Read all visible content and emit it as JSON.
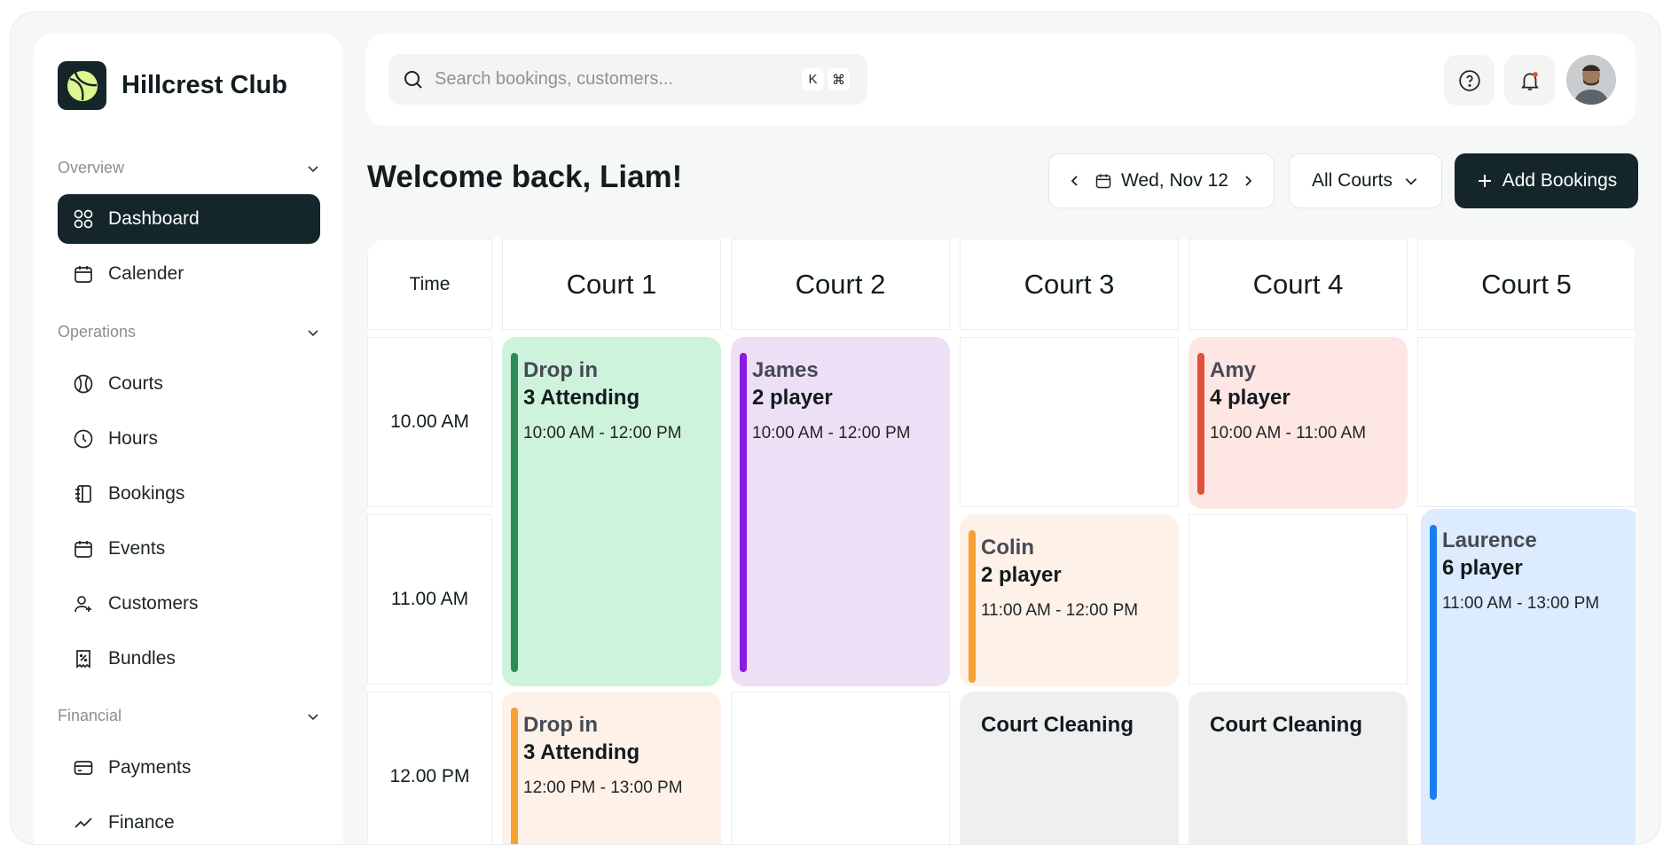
{
  "app": {
    "club_name": "Hillcrest  Club"
  },
  "sidebar": {
    "sections": [
      {
        "label": "Overview"
      },
      {
        "label": "Operations"
      },
      {
        "label": "Financial"
      }
    ],
    "items": [
      {
        "label": "Dashboard",
        "icon": "dashboard-grid-icon",
        "active": true
      },
      {
        "label": "Calender",
        "icon": "calendar-icon"
      },
      {
        "label": "Courts",
        "icon": "tennis-ball-icon"
      },
      {
        "label": "Hours",
        "icon": "clock-icon"
      },
      {
        "label": "Bookings",
        "icon": "notebook-icon"
      },
      {
        "label": "Events",
        "icon": "calendar-icon"
      },
      {
        "label": "Customers",
        "icon": "user-plus-icon"
      },
      {
        "label": "Bundles",
        "icon": "receipt-discount-icon"
      },
      {
        "label": "Payments",
        "icon": "credit-card-icon"
      },
      {
        "label": "Finance",
        "icon": "chart-icon"
      }
    ]
  },
  "topbar": {
    "search_placeholder": "Search bookings, customers...",
    "shortcut_keys": [
      "K",
      "⌘"
    ]
  },
  "header": {
    "welcome": "Welcome back, Liam!",
    "date": "Wed, Nov 12",
    "court_filter": "All Courts",
    "add_label": "Add Bookings"
  },
  "schedule": {
    "time_header": "Time",
    "courts": [
      "Court 1",
      "Court 2",
      "Court 3",
      "Court 4",
      "Court 5"
    ],
    "times": [
      "10.00 AM",
      "11.00 AM",
      "12.00 PM"
    ],
    "bookings": [
      {
        "name": "Drop in",
        "sub": "3 Attending",
        "time": "10:00 AM - 12:00 PM"
      },
      {
        "name": "James",
        "sub": "2 player",
        "time": "10:00 AM - 12:00 PM"
      },
      {
        "name": "Amy",
        "sub": "4 player",
        "time": "10:00 AM - 11:00 AM"
      },
      {
        "name": "Colin",
        "sub": "2 player",
        "time": "11:00 AM - 12:00 PM"
      },
      {
        "name": "Laurence",
        "sub": "6 player",
        "time": "11:00 AM - 13:00 PM"
      },
      {
        "name": "Drop in",
        "sub": "3 Attending",
        "time": "12:00 PM - 13:00 PM"
      },
      {
        "name": "Court Cleaning"
      },
      {
        "name": "Court Cleaning"
      }
    ]
  },
  "colors": {
    "brand_dark": "#14262a",
    "green_bg": "#cdf3dd",
    "green_bar": "#2e8b57",
    "purple_bg": "#ede0f6",
    "purple_bar": "#8a1be0",
    "red_bg": "#fde6e4",
    "red_bar": "#e0503b",
    "orange_bg": "#fef1e8",
    "orange_bar": "#f5a030",
    "blue_bg": "#dcebfd",
    "blue_bar": "#1a7ef0",
    "gray_bg": "#eeeff0"
  }
}
